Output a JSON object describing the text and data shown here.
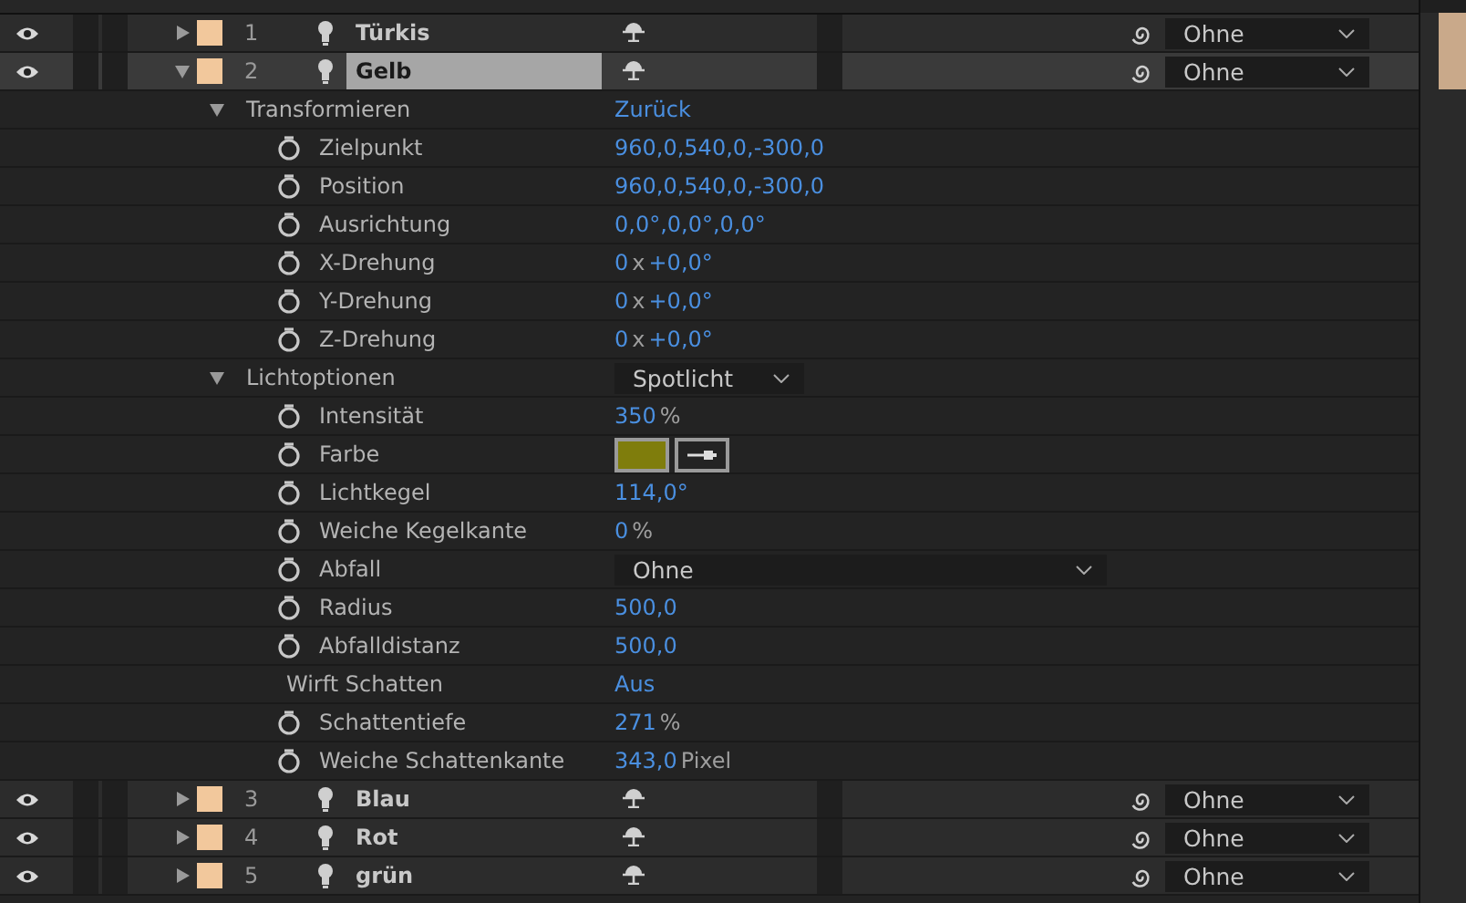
{
  "layers": [
    {
      "number": "1",
      "name": "Türkis",
      "expanded": false,
      "selected": false,
      "visible": true,
      "parent": "Ohne"
    },
    {
      "number": "2",
      "name": "Gelb",
      "expanded": true,
      "selected": true,
      "visible": true,
      "parent": "Ohne",
      "groups": [
        {
          "name": "Transformieren",
          "expanded": true,
          "reset": "Zurück",
          "properties": [
            {
              "kind": "value",
              "name": "Zielpunkt",
              "segments": [
                {
                  "text": "960,0,540,0,-300,0",
                  "unit": false
                }
              ]
            },
            {
              "kind": "value",
              "name": "Position",
              "segments": [
                {
                  "text": "960,0,540,0,-300,0",
                  "unit": false
                }
              ]
            },
            {
              "kind": "value",
              "name": "Ausrichtung",
              "segments": [
                {
                  "text": "0,0°,0,0°,0,0°",
                  "unit": false
                }
              ]
            },
            {
              "kind": "value",
              "name": "X-Drehung",
              "segments": [
                {
                  "text": "0",
                  "unit": false
                },
                {
                  "text": "x",
                  "unit": true
                },
                {
                  "text": "+0,0°",
                  "unit": false
                }
              ]
            },
            {
              "kind": "value",
              "name": "Y-Drehung",
              "segments": [
                {
                  "text": "0",
                  "unit": false
                },
                {
                  "text": "x",
                  "unit": true
                },
                {
                  "text": "+0,0°",
                  "unit": false
                }
              ]
            },
            {
              "kind": "value",
              "name": "Z-Drehung",
              "segments": [
                {
                  "text": "0",
                  "unit": false
                },
                {
                  "text": "x",
                  "unit": true
                },
                {
                  "text": "+0,0°",
                  "unit": false
                }
              ]
            }
          ]
        },
        {
          "name": "Lichtoptionen",
          "expanded": true,
          "type": "Spotlicht",
          "properties": [
            {
              "kind": "value",
              "name": "Intensität",
              "segments": [
                {
                  "text": "350",
                  "unit": false
                },
                {
                  "text": "%",
                  "unit": true
                }
              ]
            },
            {
              "kind": "color",
              "name": "Farbe",
              "color": "#7f7d0c"
            },
            {
              "kind": "value",
              "name": "Lichtkegel",
              "segments": [
                {
                  "text": "114,0°",
                  "unit": false
                }
              ]
            },
            {
              "kind": "value",
              "name": "Weiche Kegelkante",
              "segments": [
                {
                  "text": "0",
                  "unit": false
                },
                {
                  "text": "%",
                  "unit": true
                }
              ]
            },
            {
              "kind": "dropdown",
              "name": "Abfall",
              "value": "Ohne"
            },
            {
              "kind": "value",
              "name": "Radius",
              "segments": [
                {
                  "text": "500,0",
                  "unit": false
                }
              ]
            },
            {
              "kind": "value",
              "name": "Abfalldistanz",
              "segments": [
                {
                  "text": "500,0",
                  "unit": false
                }
              ]
            },
            {
              "kind": "toggle",
              "name": "Wirft Schatten",
              "value": "Aus"
            },
            {
              "kind": "value",
              "name": "Schattentiefe",
              "segments": [
                {
                  "text": "271",
                  "unit": false
                },
                {
                  "text": "%",
                  "unit": true
                }
              ]
            },
            {
              "kind": "value",
              "name": "Weiche Schattenkante",
              "segments": [
                {
                  "text": "343,0",
                  "unit": false
                },
                {
                  "text": "Pixel",
                  "unit": true
                }
              ]
            }
          ]
        }
      ]
    },
    {
      "number": "3",
      "name": "Blau",
      "expanded": false,
      "selected": false,
      "visible": true,
      "parent": "Ohne"
    },
    {
      "number": "4",
      "name": "Rot",
      "expanded": false,
      "selected": false,
      "visible": true,
      "parent": "Ohne"
    },
    {
      "number": "5",
      "name": "grün",
      "expanded": false,
      "selected": false,
      "visible": true,
      "parent": "Ohne"
    }
  ]
}
